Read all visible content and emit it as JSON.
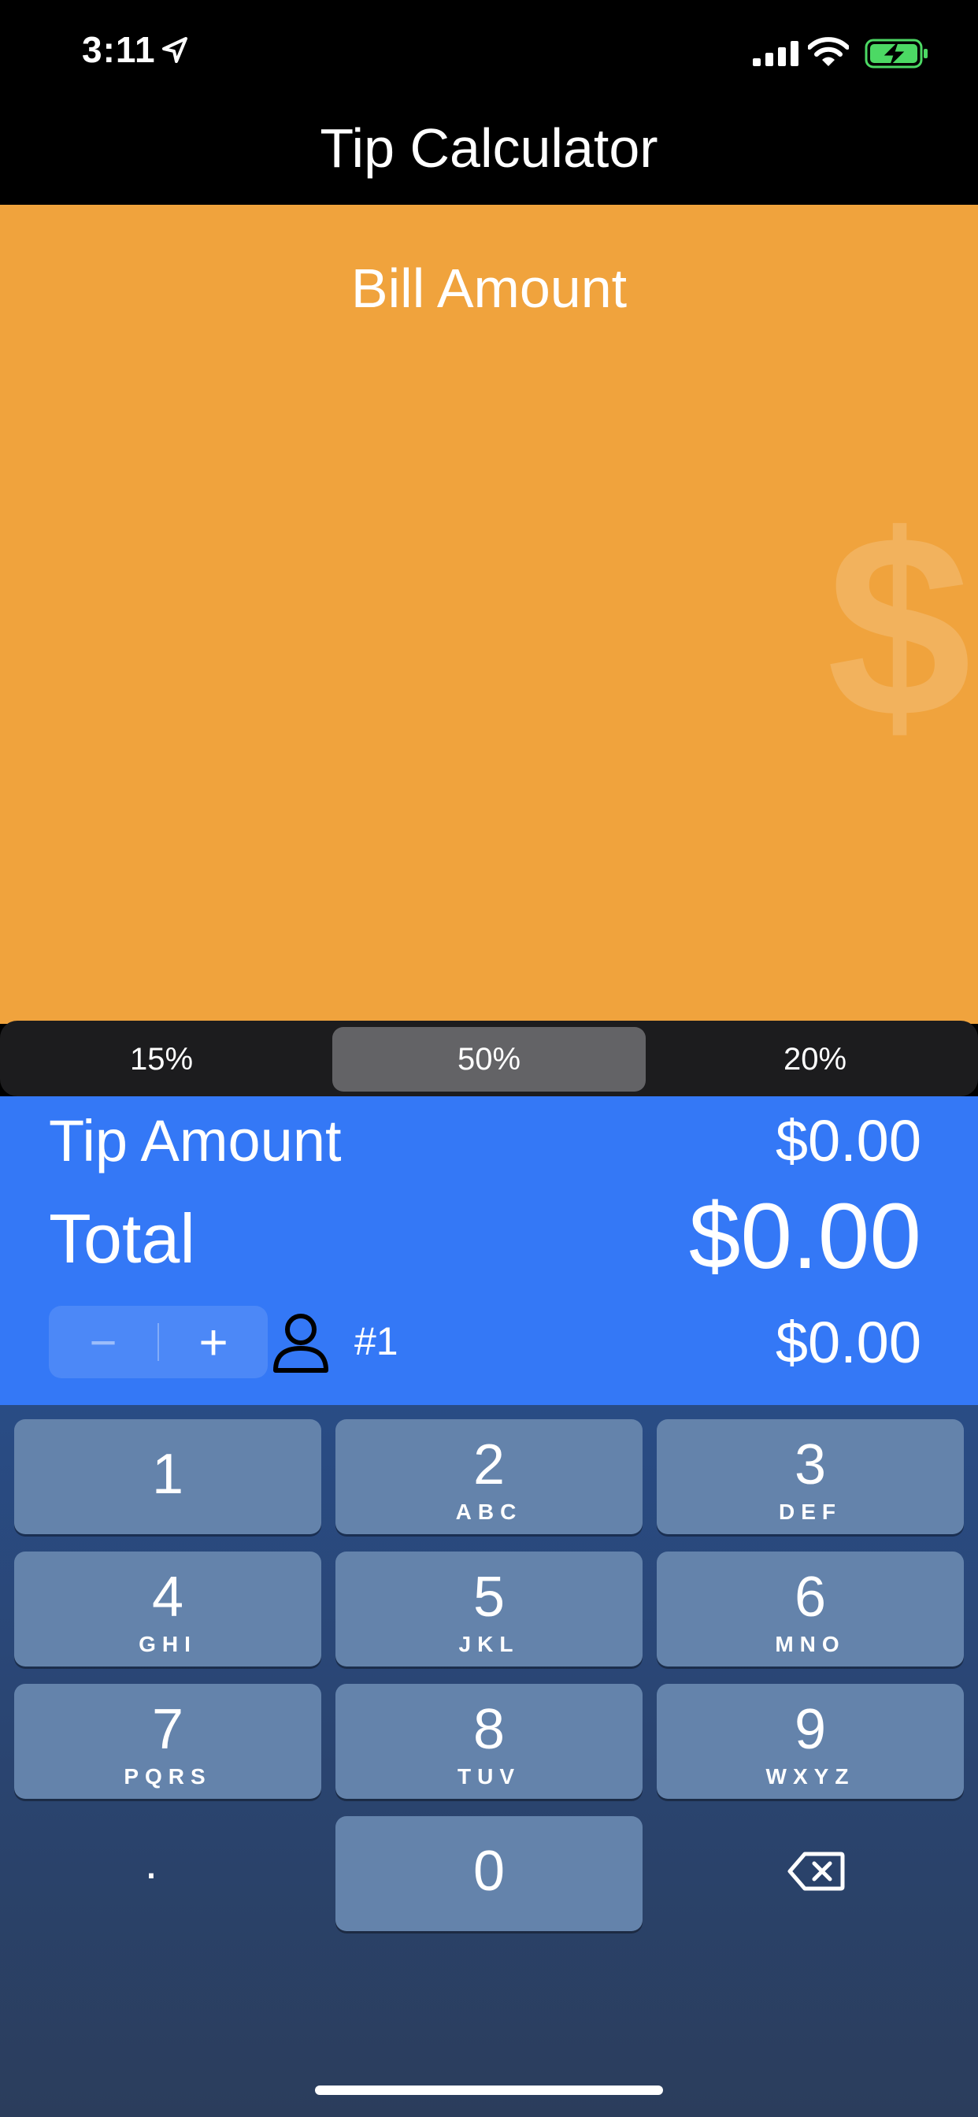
{
  "status_bar": {
    "time": "3:11"
  },
  "nav": {
    "title": "Tip Calculator"
  },
  "bill": {
    "label": "Bill Amount",
    "symbol": "$"
  },
  "tip_options": [
    "15%",
    "50%",
    "20%"
  ],
  "results": {
    "tip_label": "Tip Amount",
    "tip_value": "$0.00",
    "total_label": "Total",
    "total_value": "$0.00",
    "stepper_minus": "−",
    "stepper_plus": "+",
    "person_number": "#1",
    "per_person_value": "$0.00"
  },
  "keypad": {
    "keys": [
      {
        "digit": "1",
        "letters": ""
      },
      {
        "digit": "2",
        "letters": "ABC"
      },
      {
        "digit": "3",
        "letters": "DEF"
      },
      {
        "digit": "4",
        "letters": "GHI"
      },
      {
        "digit": "5",
        "letters": "JKL"
      },
      {
        "digit": "6",
        "letters": "MNO"
      },
      {
        "digit": "7",
        "letters": "PQRS"
      },
      {
        "digit": "8",
        "letters": "TUV"
      },
      {
        "digit": "9",
        "letters": "WXYZ"
      },
      {
        "digit": "0",
        "letters": ""
      }
    ],
    "decimal": "."
  },
  "colors": {
    "bill_bg": "#F0A33D",
    "result_bg": "#3478F6",
    "segment_bg": "#1C1C1E",
    "segment_selected": "#636366",
    "key_bg": "#6483AB",
    "battery_green": "#4CD964"
  },
  "icons": [
    "location-arrow-icon",
    "signal-bars-icon",
    "wifi-icon",
    "battery-charging-icon",
    "person-icon",
    "backspace-icon"
  ]
}
